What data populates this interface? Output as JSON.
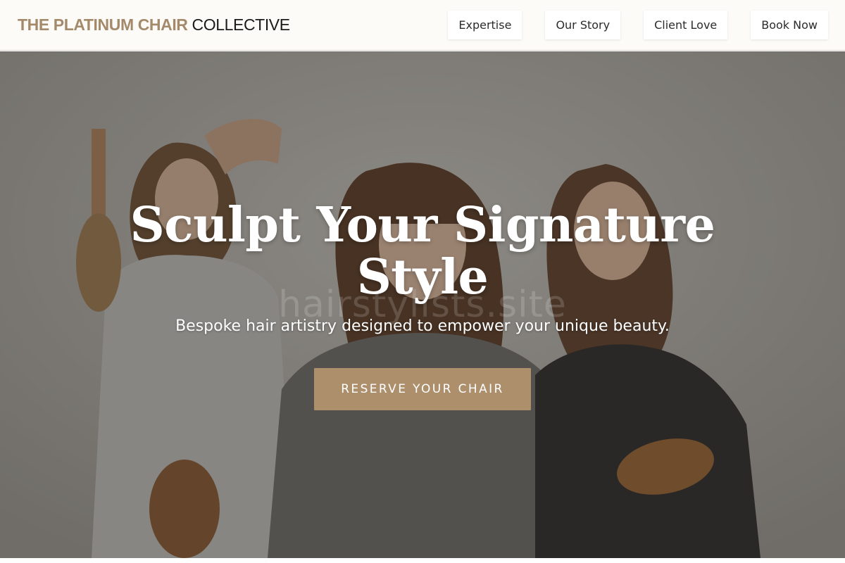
{
  "header": {
    "brand_accent": "THE PLATINUM CHAIR",
    "brand_rest": "COLLECTIVE",
    "nav": [
      "Expertise",
      "Our Story",
      "Client Love",
      "Book Now"
    ]
  },
  "hero": {
    "watermark": "hairstylists.site",
    "title": "Sculpt Your Signature Style",
    "subtitle": "Bespoke hair artistry designed to empower your unique beauty.",
    "cta_label": "RESERVE YOUR CHAIR"
  },
  "colors": {
    "accent": "#ad8f6c",
    "brand_accent": "#a48a6a",
    "nav_background": "#fcfbf8"
  }
}
